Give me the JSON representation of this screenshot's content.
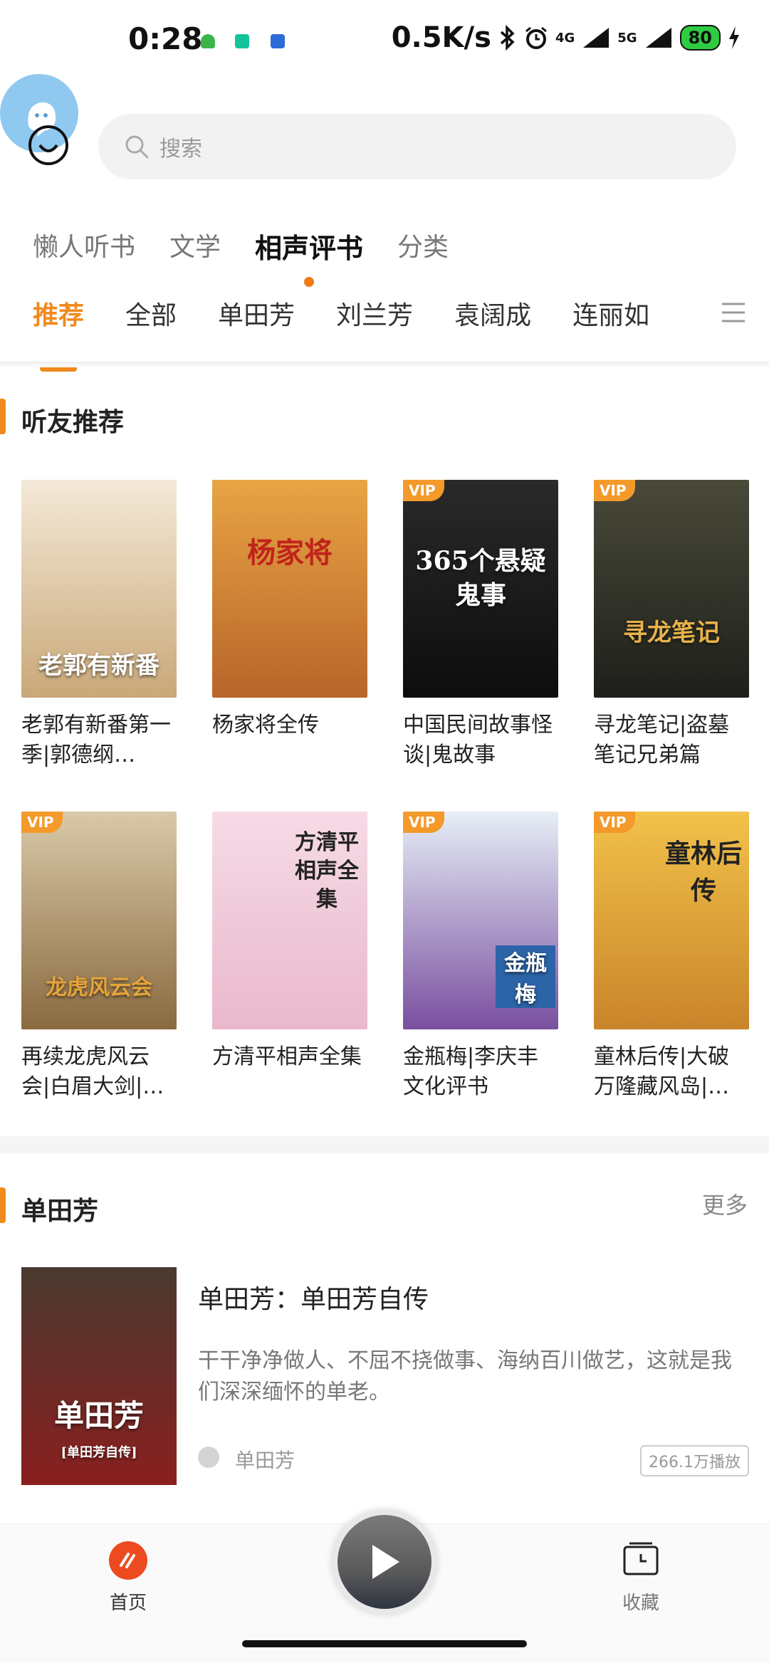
{
  "status_bar": {
    "time": "0:28",
    "net_speed": "0.5K/s",
    "net_4g": "4G",
    "net_5g": "5G",
    "battery": "80"
  },
  "search": {
    "placeholder": "搜索"
  },
  "top_tabs": [
    {
      "label": "懒人听书"
    },
    {
      "label": "文学"
    },
    {
      "label": "相声评书",
      "active": true
    },
    {
      "label": "分类"
    }
  ],
  "sub_tabs": [
    {
      "label": "推荐",
      "active": true
    },
    {
      "label": "全部"
    },
    {
      "label": "单田芳"
    },
    {
      "label": "刘兰芳"
    },
    {
      "label": "袁阔成"
    },
    {
      "label": "连丽如"
    }
  ],
  "recommend": {
    "title": "听友推荐",
    "vip_label": "VIP",
    "items": [
      {
        "title": "老郭有新番第一季|郭德纲…",
        "cover_text": "老郭有新番",
        "vip": false,
        "colors": [
          "#f4e9d8",
          "#c9a878"
        ]
      },
      {
        "title": "杨家将全传",
        "cover_text": "杨家将",
        "vip": false,
        "colors": [
          "#e8a444",
          "#b8652a"
        ]
      },
      {
        "title": "中国民间故事怪谈|鬼故事",
        "cover_text": "365个悬疑鬼事",
        "vip": true,
        "colors": [
          "#2a2a2a",
          "#0d0d0d"
        ]
      },
      {
        "title": "寻龙笔记|盗墓笔记兄弟篇",
        "cover_text": "寻龙笔记",
        "vip": true,
        "colors": [
          "#4a4a3a",
          "#1d1f1a"
        ]
      },
      {
        "title": "再续龙虎风云会|白眉大剑|…",
        "cover_text": "龙虎风云会",
        "vip": true,
        "colors": [
          "#d9c9a8",
          "#8a6a40"
        ]
      },
      {
        "title": "方清平相声全集",
        "cover_text": "方清平 相声全集",
        "vip": false,
        "colors": [
          "#f6dbe6",
          "#e9b8cc"
        ]
      },
      {
        "title": "金瓶梅|李庆丰文化评书",
        "cover_text": "金瓶梅",
        "vip": true,
        "colors": [
          "#e6eef6",
          "#7a4fa0"
        ]
      },
      {
        "title": "童林后传|大破万隆藏风岛|…",
        "cover_text": "童林后传",
        "vip": true,
        "colors": [
          "#f2c24a",
          "#c9842a"
        ]
      }
    ]
  },
  "shan_section": {
    "title": "单田芳",
    "more": "更多",
    "item": {
      "title": "单田芳：单田芳自传",
      "desc": "干干净净做人、不屈不挠做事、海纳百川做艺，这就是我们深深缅怀的单老。",
      "anchor": "单田芳",
      "plays": "266.1万播放",
      "cover_text": "单田芳",
      "cover_sub": "[单田芳自传]"
    }
  },
  "bottom_nav": {
    "home": "首页",
    "favorites": "收藏"
  },
  "colors": {
    "accent": "#f08a1e",
    "vip": "#f39a2b",
    "home_icon": "#ee4a1f"
  }
}
